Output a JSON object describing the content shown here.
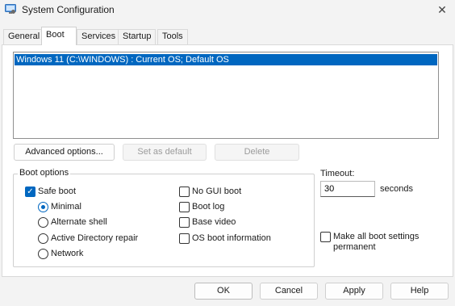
{
  "window": {
    "title": "System Configuration",
    "close_glyph": "✕",
    "icon": "system-configuration-icon"
  },
  "tabs": [
    {
      "label": "General",
      "active": false
    },
    {
      "label": "Boot",
      "active": true
    },
    {
      "label": "Services",
      "active": false
    },
    {
      "label": "Startup",
      "active": false
    },
    {
      "label": "Tools",
      "active": false
    }
  ],
  "boot_list": {
    "entries": [
      "Windows 11 (C:\\WINDOWS) : Current OS; Default OS"
    ],
    "selected_index": 0
  },
  "buttons_row": {
    "advanced": "Advanced options...",
    "set_default": "Set as default",
    "delete": "Delete"
  },
  "boot_options": {
    "legend": "Boot options",
    "safe_boot": {
      "label": "Safe boot",
      "checked": true
    },
    "radios": [
      {
        "label": "Minimal",
        "checked": true
      },
      {
        "label": "Alternate shell",
        "checked": false
      },
      {
        "label": "Active Directory repair",
        "checked": false
      },
      {
        "label": "Network",
        "checked": false
      }
    ],
    "right_checkboxes": [
      {
        "label": "No GUI boot",
        "checked": false
      },
      {
        "label": "Boot log",
        "checked": false
      },
      {
        "label": "Base video",
        "checked": false
      },
      {
        "label": "OS boot information",
        "checked": false
      }
    ]
  },
  "timeout": {
    "label": "Timeout:",
    "value": "30",
    "unit": "seconds"
  },
  "permanent": {
    "label_line1": "Make all boot settings",
    "label_line2": "permanent",
    "checked": false
  },
  "dialog_buttons": {
    "ok": "OK",
    "cancel": "Cancel",
    "apply": "Apply",
    "help": "Help"
  },
  "colors": {
    "accent": "#0067c0",
    "background": "#f3f3f3",
    "panel": "#ffffff"
  }
}
